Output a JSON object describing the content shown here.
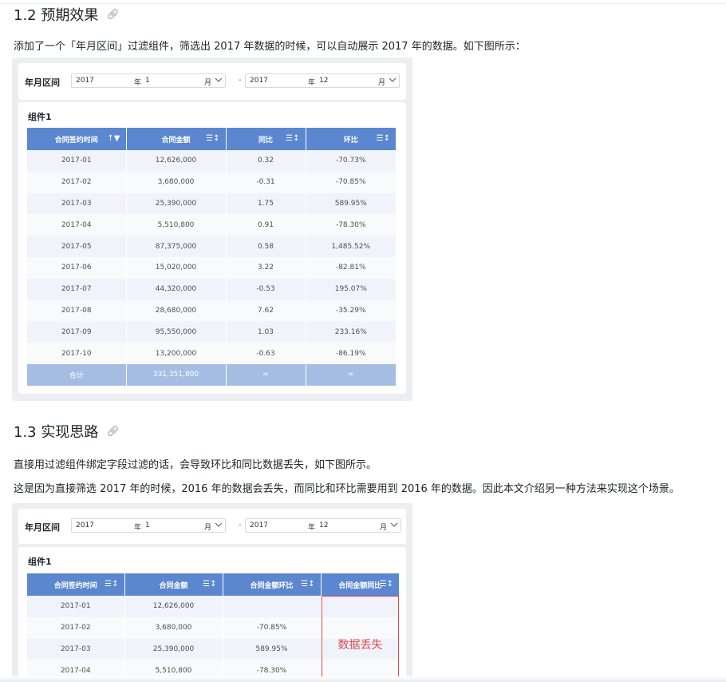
{
  "sections": [
    {
      "heading": "1.2 预期效果",
      "paragraphs": [
        "添加了一个「年月区间」过滤组件，筛选出 2017 年数据的时候，可以自动展示 2017 年的数据。如下图所示："
      ]
    },
    {
      "heading": "1.3 实现思路",
      "paragraphs": [
        "直接用过滤组件绑定字段过滤的话，会导致环比和同比数据丢失，如下图所示。",
        "这是因为直接筛选 2017 年的时候，2016 年的数据会丢失，而同比和环比需要用到 2016 年的数据。因此本文介绍另一种方法来实现这个场景。"
      ]
    }
  ],
  "icons": {
    "heading_link": "link-icon",
    "dropdown": "chevron-down-icon",
    "sort": "sort-icon",
    "sort_asc": "sort-ascending-icon"
  },
  "colors": {
    "header": "#5b87d0",
    "total_row": "#a6bde3",
    "lost_highlight": "#e0474d"
  },
  "screenshot1": {
    "filter": {
      "label": "年月区间",
      "start": {
        "year": "2017",
        "year_unit": "年",
        "month": "1",
        "month_unit": "月"
      },
      "separator": "-",
      "end": {
        "year": "2017",
        "year_unit": "年",
        "month": "12",
        "month_unit": "月"
      }
    },
    "widget_title": "组件1",
    "columns": [
      "合同签约时间",
      "合同金额",
      "同比",
      "环比"
    ],
    "rows": [
      [
        "2017-01",
        "12,626,000",
        "0.32",
        "-70.73%"
      ],
      [
        "2017-02",
        "3,680,000",
        "-0.31",
        "-70.85%"
      ],
      [
        "2017-03",
        "25,390,000",
        "1.75",
        "589.95%"
      ],
      [
        "2017-04",
        "5,510,800",
        "0.91",
        "-78.30%"
      ],
      [
        "2017-05",
        "87,375,000",
        "0.58",
        "1,485.52%"
      ],
      [
        "2017-06",
        "15,020,000",
        "3.22",
        "-82.81%"
      ],
      [
        "2017-07",
        "44,320,000",
        "-0.53",
        "195.07%"
      ],
      [
        "2017-08",
        "28,680,000",
        "7.62",
        "-35.29%"
      ],
      [
        "2017-09",
        "95,550,000",
        "1.03",
        "233.16%"
      ],
      [
        "2017-10",
        "13,200,000",
        "-0.63",
        "-86.19%"
      ]
    ],
    "total_row": [
      "合计",
      "331,351,800",
      "∞",
      "∞"
    ]
  },
  "screenshot2": {
    "filter": {
      "label": "年月区间",
      "start": {
        "year": "2017",
        "year_unit": "年",
        "month": "1",
        "month_unit": "月"
      },
      "separator": "-",
      "end": {
        "year": "2017",
        "year_unit": "年",
        "month": "12",
        "month_unit": "月"
      }
    },
    "widget_title": "组件1",
    "columns": [
      "合同签约时间",
      "合同金额",
      "合同金额环比",
      "合同金额同比"
    ],
    "rows": [
      [
        "2017-01",
        "12,626,000",
        "",
        ""
      ],
      [
        "2017-02",
        "3,680,000",
        "-70.85%",
        ""
      ],
      [
        "2017-03",
        "25,390,000",
        "589.95%",
        ""
      ],
      [
        "2017-04",
        "5,510,800",
        "-78.30%",
        ""
      ]
    ],
    "lost_label": "数据丢失"
  }
}
